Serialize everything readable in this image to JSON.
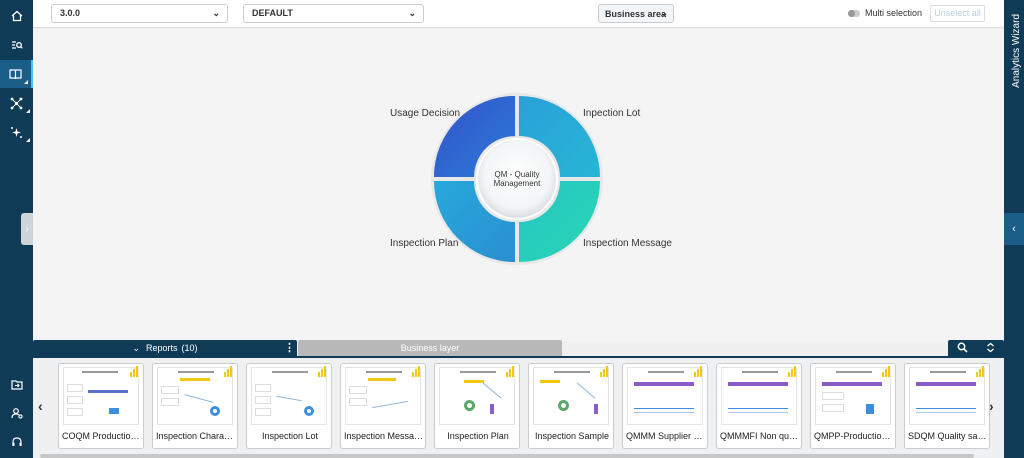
{
  "topbar": {
    "version_select": "3.0.0",
    "profile_select": "DEFAULT",
    "business_area_button": "Business area",
    "multi_selection_label": "Multi selection",
    "unselect_all_label": "Unselect all"
  },
  "wizard": {
    "label": "Analytics Wizard"
  },
  "diagram": {
    "center_label_line1": "QM - Quality",
    "center_label_line2": "Management",
    "segments": [
      {
        "label": "Usage Decision",
        "color": "#2f67d6"
      },
      {
        "label": "Inpection Lot",
        "color": "#27a5d8"
      },
      {
        "label": "Inspection Plan",
        "color": "#27a5d8"
      },
      {
        "label": "Inspection Message",
        "color": "#2ad0be"
      }
    ]
  },
  "reports": {
    "tab_label": "Reports",
    "count": "(10)",
    "business_layer_label": "Business layer",
    "cards": [
      {
        "label": "COQM Production ..."
      },
      {
        "label": "Inspection Charac..."
      },
      {
        "label": "Inspection Lot"
      },
      {
        "label": "Inspection Message"
      },
      {
        "label": "Inspection Plan"
      },
      {
        "label": "Inspection Sample"
      },
      {
        "label": "QMMM Supplier q..."
      },
      {
        "label": "QMMMFI Non qua..."
      },
      {
        "label": "QMPP-Production ..."
      },
      {
        "label": "SDQM Quality sales"
      }
    ]
  },
  "colors": {
    "nav_bg": "#0f3b57",
    "accent": "#1a5d86",
    "powerbi": "#f2c811"
  }
}
